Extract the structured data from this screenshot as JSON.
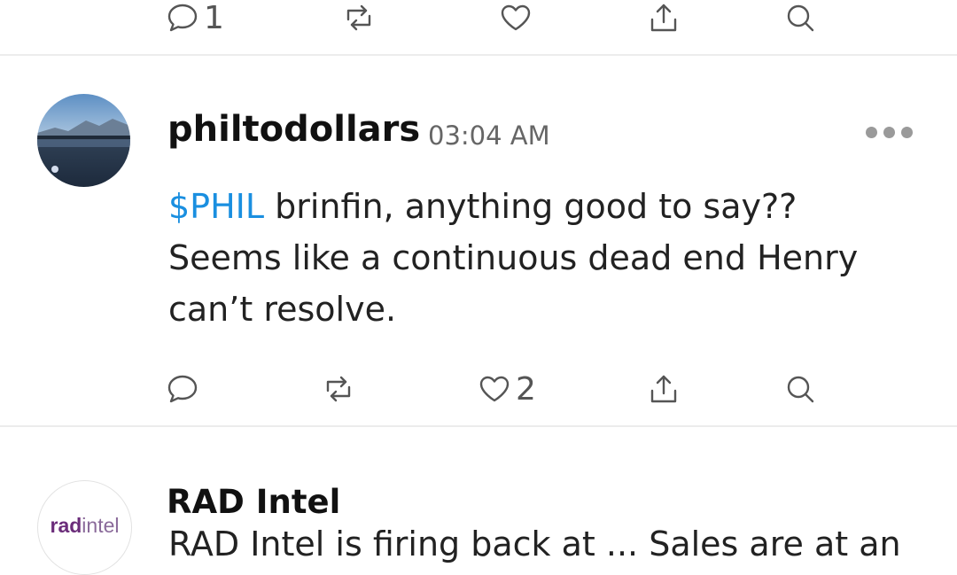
{
  "top_actions": {
    "reply_count": "1"
  },
  "post": {
    "username": "philtodollars",
    "time": "03:04 AM",
    "cashtag": "$PHIL",
    "line1_rest": " brinfin, anything good to say??",
    "line2": "Seems like a continuous dead end Henry",
    "line3": "can’t resolve.",
    "like_count": "2"
  },
  "next_post": {
    "username": "RAD Intel",
    "avatar_text_a": "rad",
    "avatar_text_b": "intel",
    "preview": "RAD Intel is firing back at ... Sales are at an"
  },
  "colors": {
    "cashtag": "#1a8fe0",
    "icon": "#555555",
    "divider": "#ececec"
  }
}
